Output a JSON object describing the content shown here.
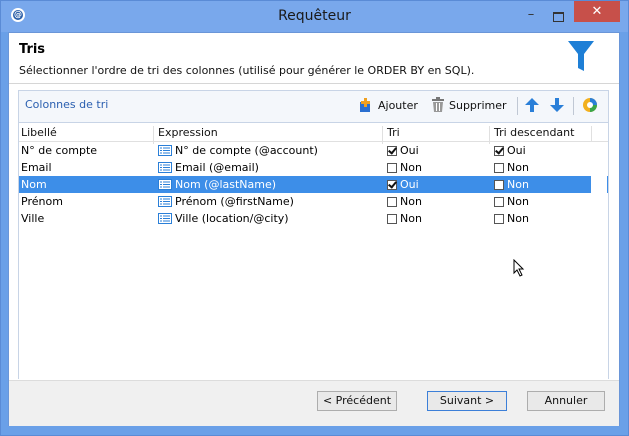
{
  "window": {
    "title": "Requêteur",
    "minimize": "–",
    "close": "✕"
  },
  "header": {
    "title": "Tris",
    "subtitle": "Sélectionner l'ordre de tri des colonnes (utilisé pour générer le ORDER BY en SQL)."
  },
  "toolbar": {
    "title": "Colonnes de tri",
    "add_label": "Ajouter",
    "delete_label": "Supprimer"
  },
  "columns": {
    "label": "Libellé",
    "expression": "Expression",
    "sort": "Tri",
    "sort_desc": "Tri descendant"
  },
  "rows": [
    {
      "label": "N° de compte",
      "expression": "N° de compte (@account)",
      "sort": "Oui",
      "sort_checked": true,
      "desc": "Oui",
      "desc_checked": true,
      "selected": false
    },
    {
      "label": "Email",
      "expression": "Email (@email)",
      "sort": "Non",
      "sort_checked": false,
      "desc": "Non",
      "desc_checked": false,
      "selected": false
    },
    {
      "label": "Nom",
      "expression": "Nom (@lastName)",
      "sort": "Oui",
      "sort_checked": true,
      "desc": "Non",
      "desc_checked": false,
      "selected": true
    },
    {
      "label": "Prénom",
      "expression": "Prénom (@firstName)",
      "sort": "Non",
      "sort_checked": false,
      "desc": "Non",
      "desc_checked": false,
      "selected": false
    },
    {
      "label": "Ville",
      "expression": "Ville (location/@city)",
      "sort": "Non",
      "sort_checked": false,
      "desc": "Non",
      "desc_checked": false,
      "selected": false
    }
  ],
  "footer": {
    "prev_label": "< Précédent",
    "next_label": "Suivant >",
    "cancel_label": "Annuler"
  },
  "colors": {
    "accent": "#3d8ee8",
    "funnel": "#1e7fd6",
    "title_text": "#2a5fb0"
  }
}
